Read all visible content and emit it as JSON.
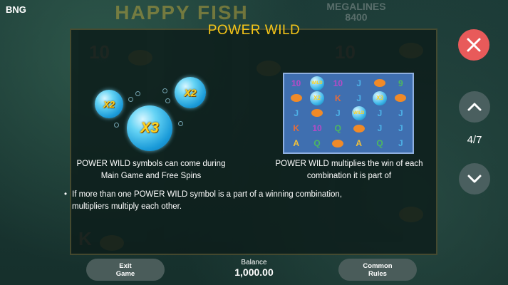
{
  "brand": "BNG",
  "background": {
    "logo": "HAPPY FISH",
    "megalines_label": "MEGALINES",
    "megalines_value": "8400"
  },
  "title": "POWER WILD",
  "bubbles": [
    {
      "label": "X2"
    },
    {
      "label": "X2"
    },
    {
      "label": "X3"
    }
  ],
  "grid": {
    "rows": [
      [
        "10",
        "WILD",
        "10",
        "J",
        "fish",
        "9"
      ],
      [
        "fish",
        "X2",
        "K",
        "J",
        "X3",
        "fish"
      ],
      [
        "J",
        "fish",
        "J",
        "WILD",
        "J",
        "J"
      ],
      [
        "K",
        "10",
        "Q",
        "fish",
        "J",
        "J"
      ],
      [
        "A",
        "Q",
        "fish",
        "A",
        "Q",
        "J"
      ]
    ]
  },
  "desc_left_line1": "POWER WILD symbols can come during",
  "desc_left_line2": "Main Game and Free Spins",
  "desc_right_line1": "POWER WILD multiplies the win of each",
  "desc_right_line2": "combination it is part of",
  "bullet_dot": "•",
  "bullet_line1": "If more than one POWER WILD symbol is a part of a winning combination,",
  "bullet_line2": "multipliers multiply each other.",
  "nav": {
    "page_counter": "4/7",
    "close_icon": "close-icon",
    "up_icon": "chevron-up-icon",
    "down_icon": "chevron-down-icon"
  },
  "bottom": {
    "exit_line1": "Exit",
    "exit_line2": "Game",
    "balance_label": "Balance",
    "balance_value": "1,000.00",
    "rules_line1": "Common",
    "rules_line2": "Rules"
  },
  "colors": {
    "title": "#f5c518",
    "close": "#e85a5a",
    "nav": "#4a5f5f"
  }
}
